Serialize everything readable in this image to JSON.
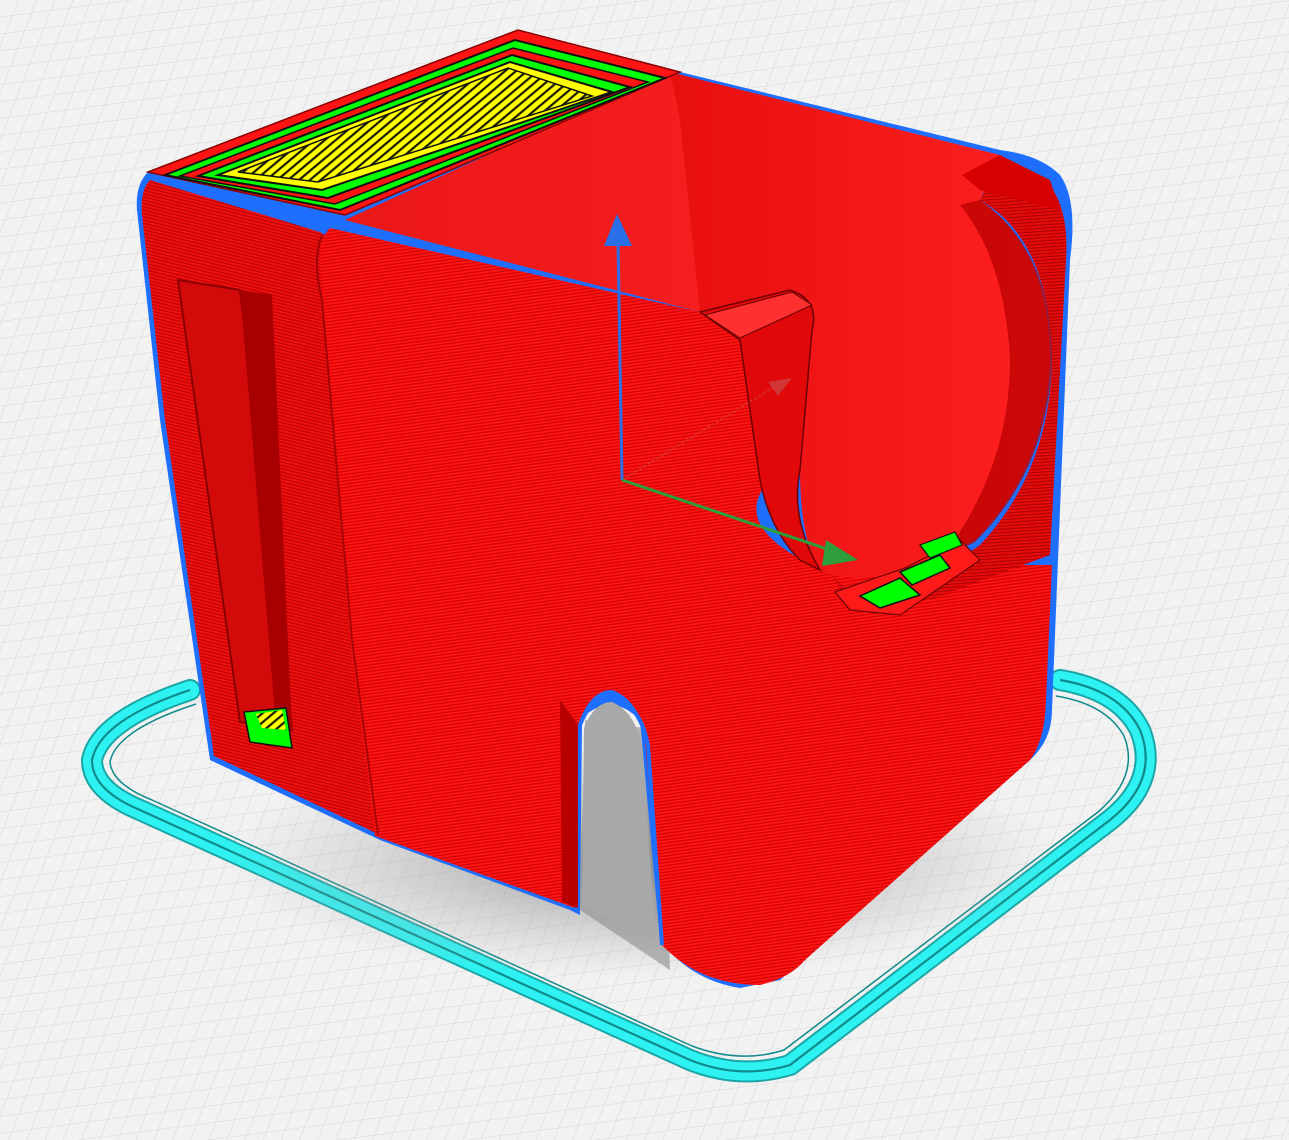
{
  "viewport": {
    "kind": "3d-slicer-layer-preview",
    "colors": {
      "background": "#f2f2f2",
      "grid_line": "#d4d4d4",
      "wall_outer": "#ff1414",
      "wall_line": "#b00000",
      "top_skin_yellow": "#ffff00",
      "skin_green": "#00ff00",
      "outer_edge_blue": "#1f6fff",
      "skirt_cyan": "#2ef2f2",
      "axis_x": "#2e9e3c",
      "axis_y": "#c43c3c",
      "axis_z": "#2a6fe8"
    },
    "objects": {
      "model": "elephant-shaped-holder",
      "skirt": "brim-outline",
      "gizmo": "xyz-axis-gizmo"
    }
  }
}
